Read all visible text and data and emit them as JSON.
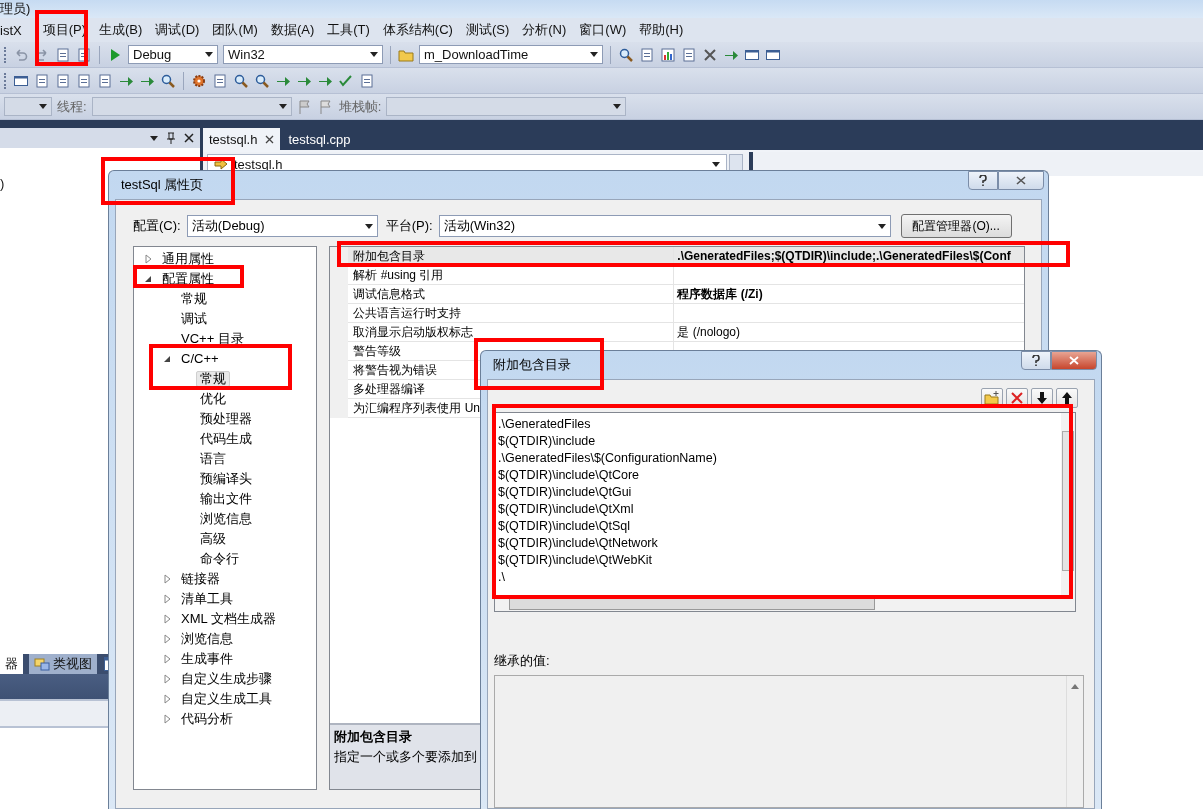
{
  "window": {
    "title": "理员)"
  },
  "menu": [
    "istX",
    "项目(P)",
    "生成(B)",
    "调试(D)",
    "团队(M)",
    "数据(A)",
    "工具(T)",
    "体系结构(C)",
    "测试(S)",
    "分析(N)",
    "窗口(W)",
    "帮助(H)"
  ],
  "toolbar": {
    "config": "Debug",
    "platform": "Win32",
    "function": "m_DownloadTime",
    "thread_label": "线程:",
    "stack_label": "堆栈帧:"
  },
  "solution_panel": {
    "text": ")",
    "bottom_tabs": [
      {
        "label": "器",
        "selected": true
      },
      {
        "label": "类视图",
        "selected": false
      }
    ]
  },
  "editor": {
    "tabs": [
      {
        "label": "testsql.h",
        "selected": true
      },
      {
        "label": "testsql.cpp",
        "selected": false
      }
    ],
    "nav": "testsql.h"
  },
  "property_dialog": {
    "title": "testSql 属性页",
    "config_label": "配置(C):",
    "config": "活动(Debug)",
    "platform_label": "平台(P):",
    "platform": "活动(Win32)",
    "manager_button": "配置管理器(O)...",
    "tree": [
      {
        "label": "通用属性",
        "expanded": false,
        "selected": false
      },
      {
        "label": "配置属性",
        "expanded": true,
        "selected": false,
        "children": [
          {
            "label": "常规",
            "selected": false
          },
          {
            "label": "调试",
            "selected": false
          },
          {
            "label": "VC++ 目录",
            "selected": false
          },
          {
            "label": "C/C++",
            "expanded": true,
            "selected": false,
            "children": [
              {
                "label": "常规",
                "selected": true
              },
              {
                "label": "优化",
                "selected": false
              },
              {
                "label": "预处理器",
                "selected": false
              },
              {
                "label": "代码生成",
                "selected": false
              },
              {
                "label": "语言",
                "selected": false
              },
              {
                "label": "预编译头",
                "selected": false
              },
              {
                "label": "输出文件",
                "selected": false
              },
              {
                "label": "浏览信息",
                "selected": false
              },
              {
                "label": "高级",
                "selected": false
              },
              {
                "label": "命令行",
                "selected": false
              }
            ]
          },
          {
            "label": "链接器",
            "expanded": false,
            "selected": false
          },
          {
            "label": "清单工具",
            "expanded": false,
            "selected": false
          },
          {
            "label": "XML 文档生成器",
            "expanded": false,
            "selected": false
          },
          {
            "label": "浏览信息",
            "expanded": false,
            "selected": false
          },
          {
            "label": "生成事件",
            "expanded": false,
            "selected": false
          },
          {
            "label": "自定义生成步骤",
            "expanded": false,
            "selected": false
          },
          {
            "label": "自定义生成工具",
            "expanded": false,
            "selected": false
          },
          {
            "label": "代码分析",
            "expanded": false,
            "selected": false
          }
        ]
      }
    ],
    "grid": [
      {
        "name": "附加包含目录",
        "value": ".\\GeneratedFiles;$(QTDIR)\\include;.\\GeneratedFiles\\$(Conf",
        "bold": true,
        "selected": true
      },
      {
        "name": "解析 #using 引用",
        "selected": false
      },
      {
        "name": "调试信息格式",
        "value": "程序数据库 (/Zi)",
        "bold": true,
        "selected": false
      },
      {
        "name": "公共语言运行时支持",
        "selected": false
      },
      {
        "name": "取消显示启动版权标志",
        "value": "是 (/nologo)",
        "bold": false,
        "selected": false
      },
      {
        "name": "警告等级",
        "selected": false
      },
      {
        "name": "将警告视为错误",
        "selected": false
      },
      {
        "name": "多处理器编译",
        "selected": false
      },
      {
        "name": "为汇编程序列表使用 Un",
        "selected": false
      }
    ],
    "description": {
      "title": "附加包含目录",
      "text": "指定一个或多个要添加到"
    }
  },
  "include_dialog": {
    "title": "附加包含目录",
    "paths": [
      ".\\GeneratedFiles",
      "$(QTDIR)\\include",
      ".\\GeneratedFiles\\$(ConfigurationName)",
      "$(QTDIR)\\include\\QtCore",
      "$(QTDIR)\\include\\QtGui",
      "$(QTDIR)\\include\\QtXml",
      "$(QTDIR)\\include\\QtSql",
      "$(QTDIR)\\include\\QtNetwork",
      "$(QTDIR)\\include\\QtWebKit",
      ".\\"
    ],
    "inherited_label": "继承的值:"
  }
}
